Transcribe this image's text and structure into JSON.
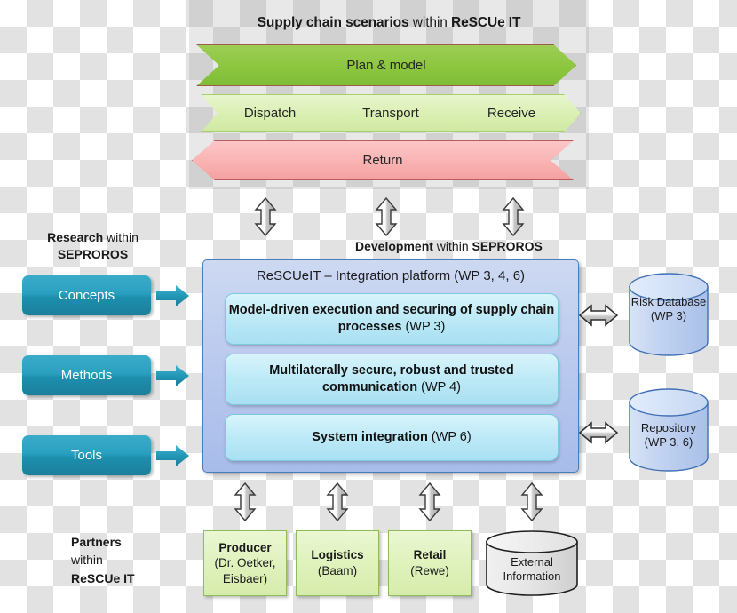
{
  "diagram": {
    "title": {
      "bold1": "Supply chain scenarios",
      "regular": " within ",
      "bold2": "ReSCUe IT"
    },
    "supply_chain": {
      "plan": "Plan & model",
      "steps": [
        "Dispatch",
        "Transport",
        "Receive"
      ],
      "return": "Return"
    },
    "labels": {
      "research": {
        "bold1": "Research",
        "regular": " within ",
        "bold2": "SEPROROS"
      },
      "development": {
        "bold1": "Development",
        "regular": " within ",
        "bold2": "SEPROROS"
      },
      "partners": {
        "bold1": "Partners",
        "regular": "within",
        "bold2": "ReSCUe IT"
      }
    },
    "research_items": [
      {
        "label": "Concepts"
      },
      {
        "label": "Methods"
      },
      {
        "label": "Tools"
      }
    ],
    "platform": {
      "title": "ReSCUeIT – Integration platform (WP 3, 4, 6)",
      "work_packages": [
        {
          "bold": "Model-driven execution and securing of supply chain processes",
          "wp": " (WP 3)"
        },
        {
          "bold": "Multilaterally secure, robust and trusted communication",
          "wp": " (WP 4)"
        },
        {
          "bold": "System integration",
          "wp": " (WP 6)"
        }
      ]
    },
    "databases": [
      {
        "name": "Risk Database",
        "wp": "(WP 3)"
      },
      {
        "name": "Repository",
        "wp": "(WP 3, 6)"
      }
    ],
    "partners": [
      {
        "bold": "Producer",
        "sub": "(Dr. Oetker, Eisbaer)"
      },
      {
        "bold": "Logistics",
        "sub": "(Baam)"
      },
      {
        "bold": "Retail",
        "sub": "(Rewe)"
      }
    ],
    "external": {
      "line1": "External",
      "line2": "Information"
    },
    "colors": {
      "plan_green": "#8cc63f",
      "step_green": "#dbf0b4",
      "return_red": "#f9b2b2",
      "teal": "#2aa0c0",
      "platform_blue": "#b9c9ee",
      "wp_cyan": "#bfeaf7",
      "partner_green": "#e0f2bd",
      "db_blue": "#bed2f0"
    }
  }
}
